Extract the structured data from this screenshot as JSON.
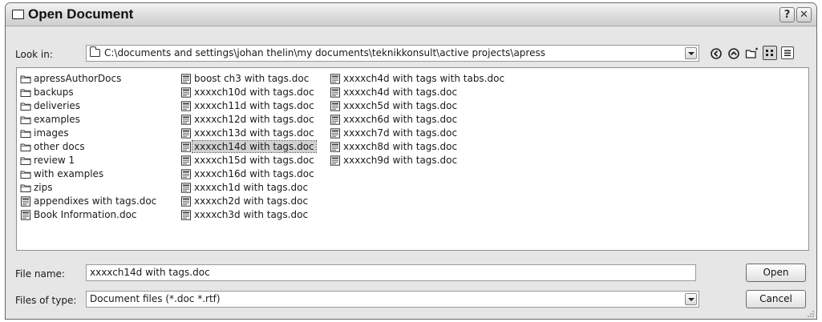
{
  "window": {
    "title": "Open Document",
    "help_label": "?",
    "close_label": "✕"
  },
  "look_in": {
    "label": "Look in:",
    "path": "C:\\documents and settings\\johan thelin\\my documents\\teknikkonsult\\active projects\\apress"
  },
  "toolbar": {
    "icons": [
      "back-icon",
      "up-folder-icon",
      "new-folder-icon",
      "list-view-icon",
      "detail-view-icon"
    ]
  },
  "files": {
    "column1": [
      {
        "name": "apressAuthorDocs",
        "type": "folder"
      },
      {
        "name": "backups",
        "type": "folder"
      },
      {
        "name": "deliveries",
        "type": "folder"
      },
      {
        "name": "examples",
        "type": "folder"
      },
      {
        "name": "images",
        "type": "folder"
      },
      {
        "name": "other docs",
        "type": "folder"
      },
      {
        "name": "review 1",
        "type": "folder"
      },
      {
        "name": "with examples",
        "type": "folder"
      },
      {
        "name": "zips",
        "type": "folder"
      },
      {
        "name": "appendixes with tags.doc",
        "type": "doc"
      },
      {
        "name": "Book Information.doc",
        "type": "doc"
      }
    ],
    "column2": [
      {
        "name": "boost ch3 with tags.doc",
        "type": "doc"
      },
      {
        "name": "xxxxch10d with tags.doc",
        "type": "doc"
      },
      {
        "name": "xxxxch11d with tags.doc",
        "type": "doc"
      },
      {
        "name": "xxxxch12d with tags.doc",
        "type": "doc"
      },
      {
        "name": "xxxxch13d with tags.doc",
        "type": "doc"
      },
      {
        "name": "xxxxch14d with tags.doc",
        "type": "doc",
        "selected": true
      },
      {
        "name": "xxxxch15d with tags.doc",
        "type": "doc"
      },
      {
        "name": "xxxxch16d with tags.doc",
        "type": "doc"
      },
      {
        "name": "xxxxch1d with tags.doc",
        "type": "doc"
      },
      {
        "name": "xxxxch2d with tags.doc",
        "type": "doc"
      },
      {
        "name": "xxxxch3d with tags.doc",
        "type": "doc"
      }
    ],
    "column3": [
      {
        "name": "xxxxch4d with tags with tabs.doc",
        "type": "doc"
      },
      {
        "name": "xxxxch4d with tags.doc",
        "type": "doc"
      },
      {
        "name": "xxxxch5d with tags.doc",
        "type": "doc"
      },
      {
        "name": "xxxxch6d with tags.doc",
        "type": "doc"
      },
      {
        "name": "xxxxch7d with tags.doc",
        "type": "doc"
      },
      {
        "name": "xxxxch8d with tags.doc",
        "type": "doc"
      },
      {
        "name": "xxxxch9d with tags.doc",
        "type": "doc"
      }
    ]
  },
  "file_name": {
    "label": "File name:",
    "value": "xxxxch14d with tags.doc"
  },
  "file_type": {
    "label": "Files of type:",
    "value": "Document files (*.doc *.rtf)"
  },
  "buttons": {
    "open": "Open",
    "cancel": "Cancel"
  }
}
